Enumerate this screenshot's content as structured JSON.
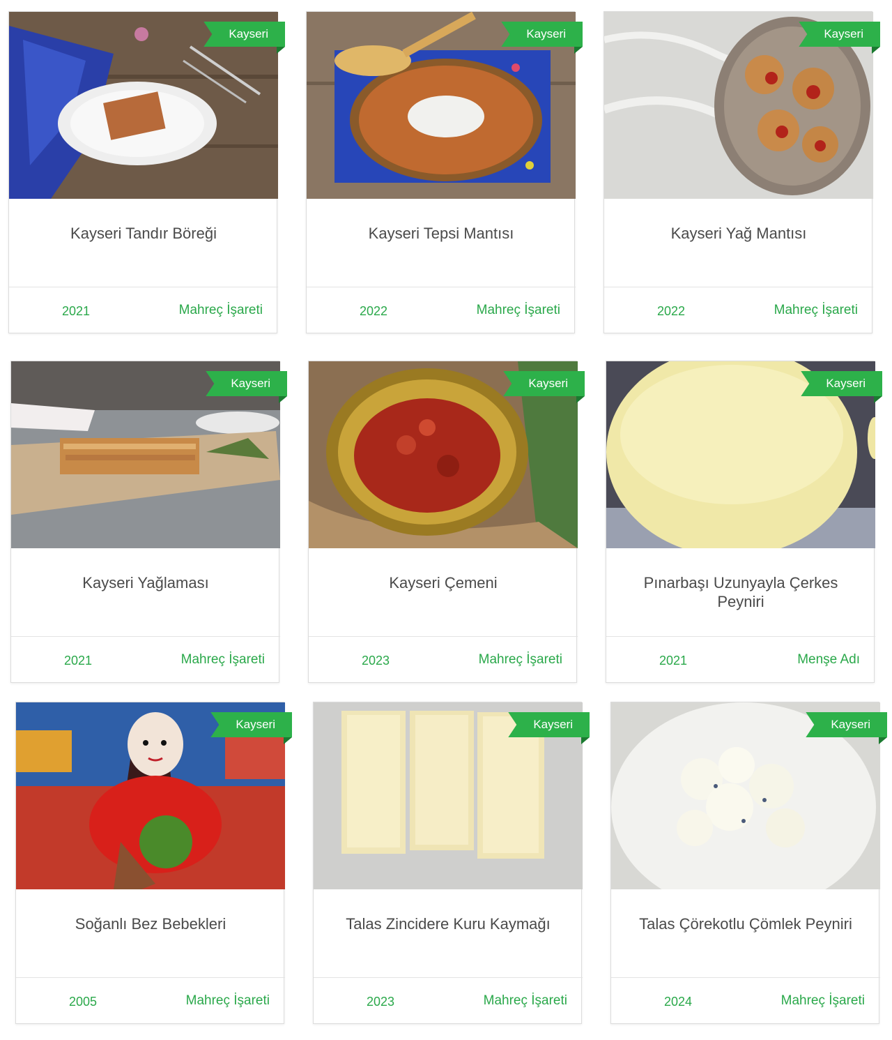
{
  "colors": {
    "accent": "#2db14a",
    "text": "#4a4a4a"
  },
  "products": [
    {
      "region": "Kayseri",
      "title": "Kayseri Tandır Böreği",
      "year": "2021",
      "type": "Mahreç İşareti"
    },
    {
      "region": "Kayseri",
      "title": "Kayseri Tepsi Mantısı",
      "year": "2022",
      "type": "Mahreç İşareti"
    },
    {
      "region": "Kayseri",
      "title": "Kayseri Yağ Mantısı",
      "year": "2022",
      "type": "Mahreç İşareti"
    },
    {
      "region": "Kayseri",
      "title": "Kayseri Yağlaması",
      "year": "2021",
      "type": "Mahreç İşareti"
    },
    {
      "region": "Kayseri",
      "title": "Kayseri Çemeni",
      "year": "2023",
      "type": "Mahreç İşareti"
    },
    {
      "region": "Kayseri",
      "title": "Pınarbaşı Uzunyayla Çerkes Peyniri",
      "year": "2021",
      "type": "Menşe Adı"
    },
    {
      "region": "Kayseri",
      "title": "Soğanlı Bez Bebekleri",
      "year": "2005",
      "type": "Mahreç İşareti"
    },
    {
      "region": "Kayseri",
      "title": "Talas Zincidere Kuru Kaymağı",
      "year": "2023",
      "type": "Mahreç İşareti"
    },
    {
      "region": "Kayseri",
      "title": "Talas Çörekotlu Çömlek Peyniri",
      "year": "2024",
      "type": "Mahreç İşareti"
    }
  ]
}
